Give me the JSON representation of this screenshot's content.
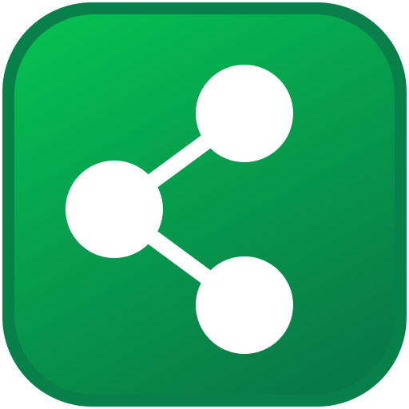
{
  "icon": {
    "name": "share-icon",
    "colors": {
      "outer_rim": "#07804a",
      "face_top": "#05bd52",
      "face_bottom": "#087a47",
      "glyph": "#ffffff"
    }
  }
}
